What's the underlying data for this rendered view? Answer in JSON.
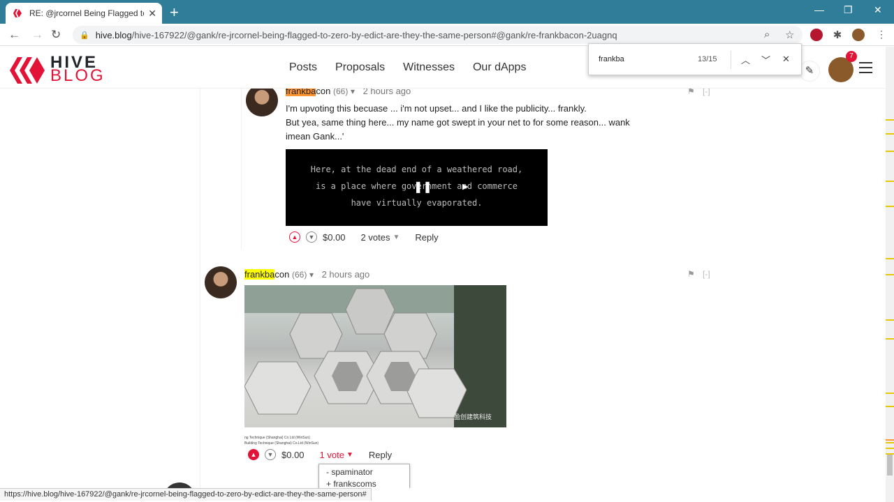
{
  "browser": {
    "tab_title": "RE: @jrcornel Being Flagged to Z",
    "url_host": "hive.blog",
    "url_path": "/hive-167922/@gank/re-jrcornel-being-flagged-to-zero-by-edict-are-they-the-same-person#@gank/re-frankbacon-2uagnq",
    "status_url": "https://hive.blog/hive-167922/@gank/re-jrcornel-being-flagged-to-zero-by-edict-are-they-the-same-person#"
  },
  "find": {
    "query": "frankba",
    "count": "13/15"
  },
  "site": {
    "logo_line1": "HIVE",
    "logo_line2": "BLOG",
    "nav": [
      "Posts",
      "Proposals",
      "Witnesses",
      "Our dApps"
    ],
    "notifications": "7"
  },
  "comment1": {
    "author_match": "frankba",
    "author_rest": "con",
    "rep": "(66)",
    "time": "2 hours ago",
    "line1": "I'm upvoting this becuase ... i'm not upset... and I like the publicity... frankly.",
    "line2": "But yea, same thing here... my name got swept in your net to for some reason... wank imean Gank...'",
    "video_lines": [
      "Here, at the dead end of a weathered road,",
      "is a place where government and commerce",
      "have virtually evaporated."
    ],
    "payout": "$0.00",
    "votes": "2 votes",
    "reply": "Reply",
    "collapse": "[-]"
  },
  "comment2": {
    "author_match": "frankba",
    "author_rest": "con",
    "rep": "(66)",
    "time": "2 hours ago",
    "image_watermark": "盈创建筑科技",
    "caption_line1": "ng Technique (Shanghai) Co Ltd (WinSun)",
    "caption_line2": "Building Technique (Shanghai) Co.Ltd (WinSun)",
    "payout": "$0.00",
    "votes": "1 vote",
    "reply": "Reply",
    "collapse": "[-]",
    "voters": [
      "- spaminator",
      "+ frankscoms"
    ]
  },
  "comment3": {
    "collapse": "[-]"
  },
  "colors": {
    "tabbar": "#2f7d98",
    "hive_red": "#e31337",
    "find_highlight": "#ffff00",
    "find_current": "#ff9632"
  }
}
